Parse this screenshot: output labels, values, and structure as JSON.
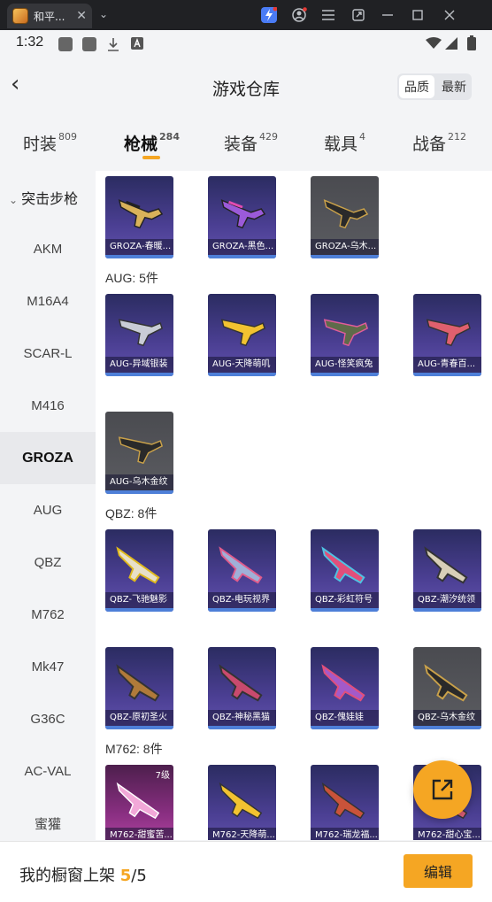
{
  "window": {
    "tab_title": "和平...",
    "tab_close": "✕",
    "dropdown": "⌄",
    "buttons": [
      "lightning-icon",
      "account-icon",
      "menu-icon",
      "screenshot-icon",
      "minimize-icon",
      "maximize-icon",
      "close-icon"
    ]
  },
  "status": {
    "time": "1:32"
  },
  "header": {
    "back": "‹",
    "title": "游戏仓库",
    "sort_options": [
      "品质",
      "最新"
    ],
    "sort_selected": "品质"
  },
  "categories": [
    {
      "label": "时装",
      "count": "809"
    },
    {
      "label": "枪械",
      "count": "284"
    },
    {
      "label": "装备",
      "count": "429"
    },
    {
      "label": "载具",
      "count": "4"
    },
    {
      "label": "战备",
      "count": "212"
    }
  ],
  "active_category": "枪械",
  "sidebar": {
    "header": "突击步枪",
    "items": [
      "AKM",
      "M16A4",
      "SCAR-L",
      "M416",
      "GROZA",
      "AUG",
      "QBZ",
      "M762",
      "Mk47",
      "G36C",
      "AC-VAL",
      "蜜獾"
    ],
    "active": "GROZA"
  },
  "groups": {
    "groza": {
      "items": [
        "GROZA-春暖...",
        "GROZA-黑色...",
        "GROZA-乌木..."
      ]
    },
    "aug": {
      "title": "AUG: 5件",
      "items": [
        "AUG-异域银装",
        "AUG-天降萌叽",
        "AUG-怪笑疯兔",
        "AUG-青春百...",
        "AUG-乌木金纹"
      ]
    },
    "qbz": {
      "title": "QBZ: 8件",
      "items": [
        "QBZ-飞驰魅影",
        "QBZ-电玩视界",
        "QBZ-彩虹符号",
        "QBZ-潮汐统领",
        "QBZ-原初圣火",
        "QBZ-神秘黑猫",
        "QBZ-傀娃娃",
        "QBZ-乌木金纹"
      ]
    },
    "m762": {
      "title": "M762: 8件",
      "items": [
        "M762-甜蜜苦...",
        "M762-天降萌...",
        "M762-瑞龙福...",
        "M762-甜心宝..."
      ],
      "level": "7级"
    }
  },
  "footer": {
    "label": "我的橱窗上架",
    "current": "5",
    "total": "/5",
    "edit_button": "编辑"
  }
}
